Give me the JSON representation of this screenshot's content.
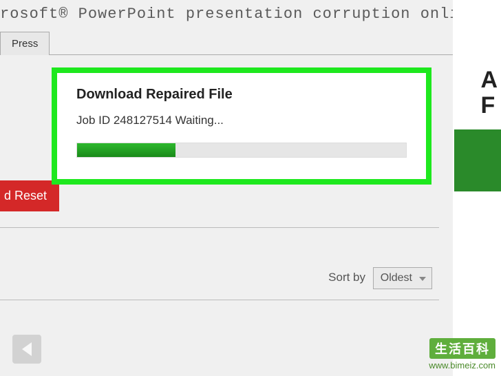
{
  "header": {
    "title": "rosoft® PowerPoint presentation corruption online"
  },
  "tabs": {
    "press": "Press"
  },
  "dialog": {
    "title": "Download Repaired File",
    "status": "Job ID 248127514 Waiting...",
    "progress_percent": 30
  },
  "buttons": {
    "reset": "d Reset"
  },
  "sort": {
    "label": "Sort by",
    "selected": "Oldest"
  },
  "rightPanel": {
    "line1": "A",
    "line2": "F"
  },
  "watermark": {
    "brand": "生活百科",
    "url": "www.bimeiz.com"
  }
}
